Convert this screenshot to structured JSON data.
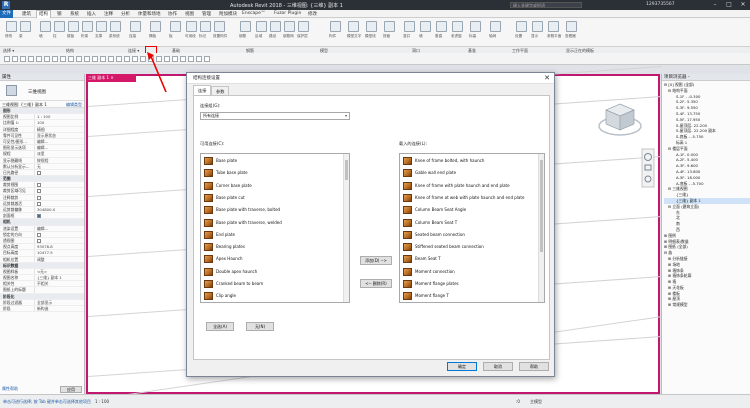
{
  "titlebar": {
    "app_logo": "R",
    "title": "Autodesk Revit 2018 -                       三维视图: {三维} 副本 1",
    "search_placeholder": "键入关键字或短语",
    "user": "1293735567",
    "min": "–",
    "max": "□",
    "close": "✕"
  },
  "menu": [
    "文件",
    "建筑",
    "结构",
    "钢",
    "系统",
    "插入",
    "注释",
    "分析",
    "体量和场地",
    "协作",
    "视图",
    "管理",
    "附加模块",
    "Enscape™",
    "Fuzor Plugin",
    "修改"
  ],
  "ribbon_groups": [
    "选择 ▾",
    "结构",
    "连接 ▾",
    "基础",
    "钢筋",
    "模型",
    "洞口",
    "基准",
    "工作平面",
    "显示正在的模板"
  ],
  "ribbon_tools": [
    "修改",
    "梁",
    "墙",
    "柱",
    "楼板",
    "桁架",
    "支撑",
    "梁系统",
    "连接",
    "隔板",
    "板",
    "可用段",
    "标记",
    "放置构件",
    "钢筋",
    "区域",
    "路径",
    "钢筋网",
    "保护层",
    "构件",
    "模型文字",
    "模型线",
    "按面",
    "竖井",
    "墙",
    "垂直",
    "老虎窗",
    "标高",
    "轴网",
    "设置",
    "显示",
    "参照平面",
    "查看器"
  ],
  "properties": {
    "header": "属性",
    "type_label": "三维视图",
    "selector": "三维视图: {三维} 副本 1",
    "edit_type": "编辑类型",
    "rows": [
      {
        "k": "图形",
        "v": "",
        "sec": true
      },
      {
        "k": "视图比例",
        "v": "1 : 100"
      },
      {
        "k": "比例值 1:",
        "v": "100"
      },
      {
        "k": "详细程度",
        "v": "精细"
      },
      {
        "k": "零件可见性",
        "v": "显示原状态"
      },
      {
        "k": "可见性/图形...",
        "v": "编辑..."
      },
      {
        "k": "图形显示选项",
        "v": "编辑..."
      },
      {
        "k": "规程",
        "v": "派里"
      },
      {
        "k": "显示隐藏线",
        "v": "按规程"
      },
      {
        "k": "默认分析显示...",
        "v": "无"
      },
      {
        "k": "日光路径",
        "v": "",
        "cb": false
      },
      {
        "k": "范围",
        "v": "",
        "sec": true
      },
      {
        "k": "裁剪视图",
        "v": "",
        "cb": false
      },
      {
        "k": "裁剪区域可见",
        "v": "",
        "cb": false
      },
      {
        "k": "注释裁剪",
        "v": "",
        "cb": false
      },
      {
        "k": "远剪裁激活",
        "v": "",
        "cb": false
      },
      {
        "k": "远剪裁偏移",
        "v": "304800.0"
      },
      {
        "k": "剖面框",
        "v": "",
        "cb": true
      },
      {
        "k": "相机",
        "v": "",
        "sec": true
      },
      {
        "k": "渲染设置",
        "v": "编辑..."
      },
      {
        "k": "锁定的方向",
        "v": "",
        "cb": false
      },
      {
        "k": "透视图",
        "v": "",
        "cb": false
      },
      {
        "k": "视点高度",
        "v": "93078.8"
      },
      {
        "k": "目标高度",
        "v": "10477.5"
      },
      {
        "k": "相机位置",
        "v": "调整"
      },
      {
        "k": "标识数据",
        "v": "",
        "sec": true
      },
      {
        "k": "视图样板",
        "v": "<无>"
      },
      {
        "k": "视图名称",
        "v": "{三维} 副本 1"
      },
      {
        "k": "相关性",
        "v": "不相关"
      },
      {
        "k": "图纸上的标题",
        "v": ""
      },
      {
        "k": "阶段化",
        "v": "",
        "sec": true
      },
      {
        "k": "阶段过滤器",
        "v": "全部显示"
      },
      {
        "k": "阶段",
        "v": "新构造"
      }
    ],
    "help_link": "属性帮助",
    "apply": "应用"
  },
  "view_tab": "三维 副本 1 ✕",
  "browser": {
    "header": "项目浏览器 -             ",
    "items": [
      {
        "t": "⊟ [0] 视图 (全部)",
        "d": 0
      },
      {
        "t": "⊟ 结构平面",
        "d": 1
      },
      {
        "t": "S-1F - -0.300",
        "d": 3
      },
      {
        "t": "S-2F- 5.350",
        "d": 3
      },
      {
        "t": "S-3F- 9.550",
        "d": 3
      },
      {
        "t": "S-4F- 13.750",
        "d": 3
      },
      {
        "t": "S-5F- 17.950",
        "d": 3
      },
      {
        "t": "S-屋顶层- 22.200",
        "d": 3
      },
      {
        "t": "S-屋顶层- 22.200 副本",
        "d": 3
      },
      {
        "t": "S-底板 - -5.750",
        "d": 3
      },
      {
        "t": "标高 1",
        "d": 3
      },
      {
        "t": "⊟ 楼层平面",
        "d": 1
      },
      {
        "t": "A-1F- 0.000",
        "d": 3
      },
      {
        "t": "A-2F- 5.400",
        "d": 3
      },
      {
        "t": "A-3F- 9.600",
        "d": 3
      },
      {
        "t": "A-4F- 13.800",
        "d": 3
      },
      {
        "t": "A-5F- 18.000",
        "d": 3
      },
      {
        "t": "A-底板 - -5.700",
        "d": 3
      },
      {
        "t": "⊟ 三维视图",
        "d": 1
      },
      {
        "t": "{三维}",
        "d": 3
      },
      {
        "t": "{三维} 副本 1",
        "d": 3,
        "sel": true
      },
      {
        "t": "⊟ 立面 (建筑立面)",
        "d": 1
      },
      {
        "t": "东",
        "d": 3
      },
      {
        "t": "北",
        "d": 3
      },
      {
        "t": "南",
        "d": 3
      },
      {
        "t": "西",
        "d": 3
      },
      {
        "t": "⊞ 图例",
        "d": 0
      },
      {
        "t": "⊞ 明细表/数量",
        "d": 0
      },
      {
        "t": "⊞ 图纸 (全部)",
        "d": 0
      },
      {
        "t": "⊟ 族",
        "d": 0
      },
      {
        "t": "⊞ 分析链接",
        "d": 1
      },
      {
        "t": "⊞ 场地",
        "d": 1
      },
      {
        "t": "⊞ 墙饰条",
        "d": 1
      },
      {
        "t": "⊞ 墙饰条轮廓",
        "d": 1
      },
      {
        "t": "⊞ 墙",
        "d": 1
      },
      {
        "t": "⊞ 天花板",
        "d": 1
      },
      {
        "t": "⊞ 楼板",
        "d": 1
      },
      {
        "t": "⊞ 屋顶",
        "d": 1
      },
      {
        "t": "⊞ 常规模型",
        "d": 1
      }
    ]
  },
  "status": {
    "left": "单击可进行选择; 按 Tab 键并单击可选择其他项目",
    "scale": "1 : 100",
    "model": ":0",
    "workset": "主模型"
  },
  "dialog": {
    "title": "结构连接设置",
    "close": "✕",
    "tabs": [
      "连接",
      "参数"
    ],
    "group_label": "连接组(G):",
    "group_value": "所有连接",
    "available_label": "可用连接(C):",
    "loaded_label": "载入的连接(L):",
    "available": [
      "Base plate",
      "Tube base plate",
      "Corner base plate",
      "Base plate cut",
      "Base plate with traverse, bolted",
      "Base plate with traverse, welded",
      "End plate",
      "Bearing plates",
      "Apex Haunch",
      "Double apex haunch",
      "Cranked beam to beam",
      "Clip angle"
    ],
    "loaded": [
      "Knee of frame bolted, with haunch",
      "Gable wall end plate",
      "Knee of frame with plate haunch and end plate",
      "Knee of frame at web with plate haunch and end plate",
      "Column Beam Seat Angle",
      "Column Beam Seat T",
      "Seated beam connection",
      "Stiffened seated beam connection",
      "Beam Seat T",
      "Moment connection",
      "Moment flange plates",
      "Moment flange T"
    ],
    "add_btn": "添加(D) -->",
    "remove_btn": "<-- 删除(R)",
    "select_all": "全选(A)",
    "select_none": "无(N)",
    "ok": "确定",
    "cancel": "取消",
    "help": "帮助"
  },
  "colors": {
    "accent": "#1e6bb8",
    "view_border": "#c0186f",
    "highlight": "#e00000"
  }
}
